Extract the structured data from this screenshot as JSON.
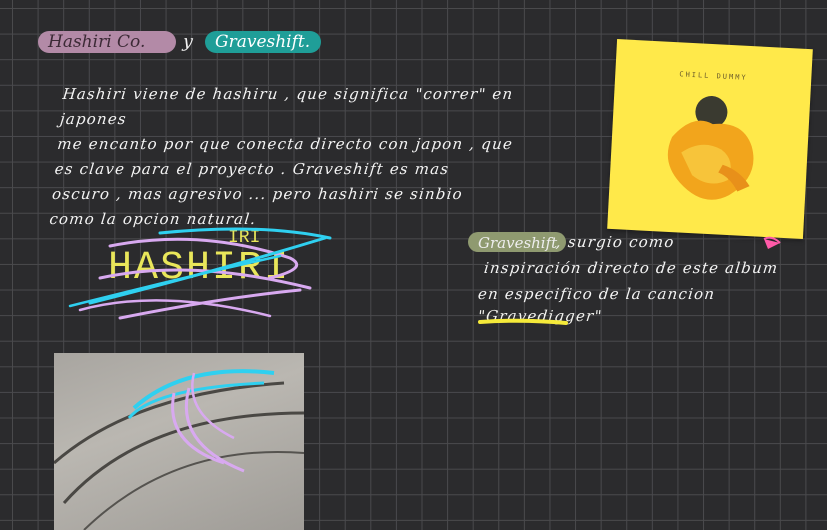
{
  "header": {
    "tag_brand": "Hashiri Co.",
    "connector": "y",
    "tag_artist": "Graveshift."
  },
  "note_main": {
    "lines": [
      "Hashiri viene de hashiru , que significa \"correr\" en japones",
      "me encanto por que conecta directo con japon , que",
      "es clave para el proyecto . Graveshift es mas",
      "oscuro , mas agresivo ... pero hashiri se sinbio",
      "como la opcion natural."
    ]
  },
  "note_side": {
    "tag": "Graveshift",
    "line1": ", surgio como",
    "line2": "inspiración directo de este album",
    "line3": "en especifico de la cancion",
    "song": "\"Gravedigger\""
  },
  "sketch": {
    "text_main": "HASHIRI",
    "text_small": "IRI"
  },
  "album": {
    "label": "CHILL DUMMY"
  },
  "colors": {
    "background": "#2b2b2d",
    "grid": "#4a4a4d",
    "pill_pink": "#b38aa7",
    "pill_teal": "#1f9e98",
    "pill_green": "#8f9a70",
    "highlight_yellow": "#f5ea3a",
    "stroke_cyan": "#2fd0f0",
    "stroke_lilac": "#d8a9f0",
    "album_yellow": "#ffe94a"
  }
}
